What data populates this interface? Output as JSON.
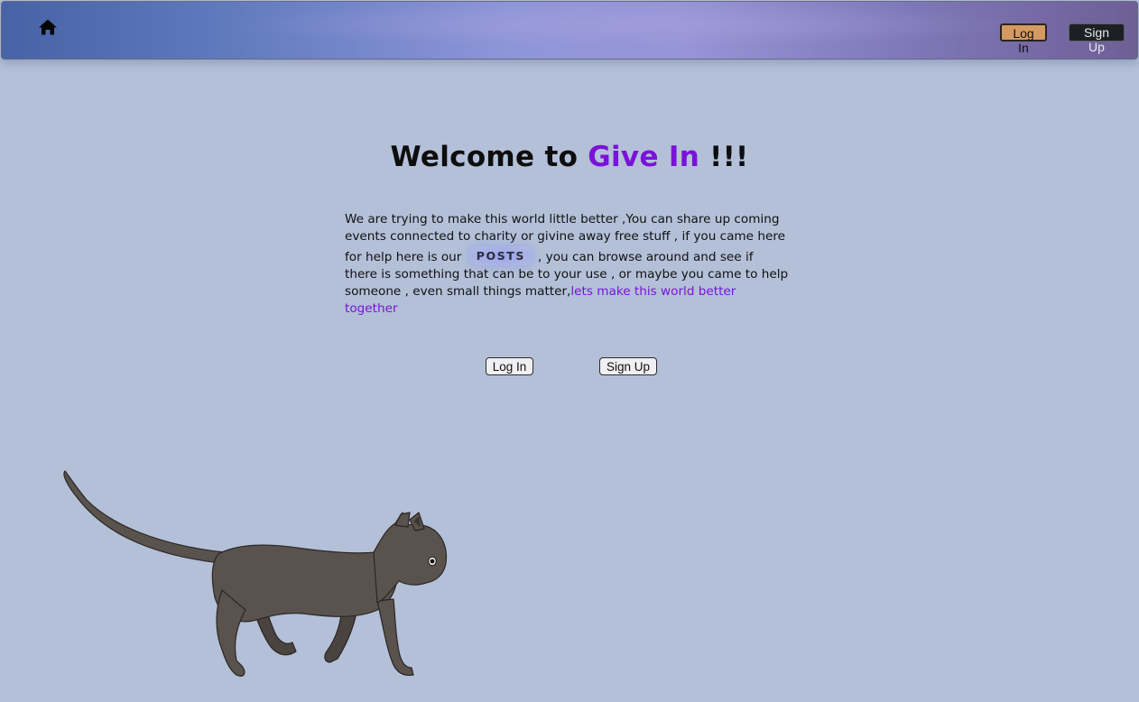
{
  "header": {
    "login_label": "Log In",
    "signup_label": "Sign Up",
    "home_icon": "home-icon"
  },
  "hero": {
    "title_prefix": "Welcome to ",
    "title_brand": "Give In",
    "title_suffix": " !!!",
    "intro_part1": "We are trying to make this world little better ,You can share up coming events connected to charity or givine away free stuff , if you came here for help here is our",
    "posts_label": "POSTS",
    "intro_part2": ", you can browse around and see if there is something that can be to your use , or maybe you came to help someone , even small things matter,",
    "together_link": "lets make this world better together"
  },
  "actions": {
    "login_label": "Log In",
    "signup_label": "Sign Up"
  },
  "illustrations": {
    "moon_icon": "crescent-moon",
    "cat_icon": "walking-cat"
  },
  "colors": {
    "background": "#b3c0d8",
    "brand": "#7a12d8",
    "nav_login_bg": "#d59a62",
    "nav_signup_bg": "#1d1f24",
    "moon": "#f3f6dc",
    "cat": "#5a524d"
  }
}
